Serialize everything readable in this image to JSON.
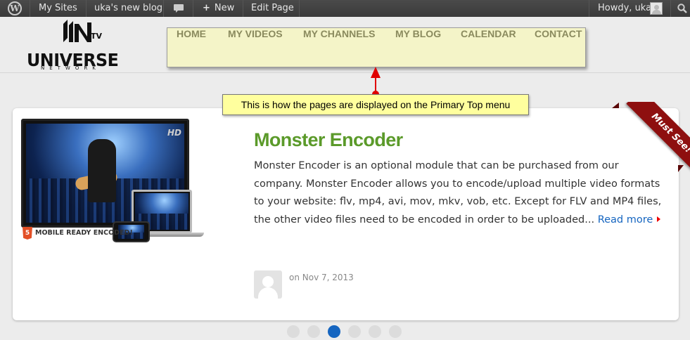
{
  "adminbar": {
    "my_sites": "My Sites",
    "site_name": "uka's new blog",
    "new_label": "New",
    "edit_page": "Edit Page",
    "greeting": "Howdy, uka"
  },
  "logo": {
    "brand": "UNIVERSE",
    "network": "NETWORK",
    "tv": "TV"
  },
  "menu": {
    "items": [
      "HOME",
      "MY VIDEOS",
      "MY CHANNELS",
      "MY BLOG",
      "CALENDAR",
      "CONTACT"
    ]
  },
  "callout": {
    "text": "This is how the pages are displayed on the Primary Top menu",
    "color": "#ffff9e",
    "arrow_color": "#e00000"
  },
  "post": {
    "title": "Monster Encoder",
    "description": "Monster Encoder is an optional module that can be purchased from our company. Monster Encoder allows you to encode/upload multiple video formats to your website: flv, mp4, avi, mov, mkv, vob, etc. Except for FLV and MP4 files, the other video files need to be encoded in order to be uploaded...",
    "read_more": "Read more",
    "date": "on Nov 7, 2013",
    "ribbon": "Must See!",
    "image_badge": "MOBILE READY ENCODED!",
    "image_hd": "HD",
    "html5": "5"
  },
  "pagination": {
    "count": 6,
    "active_index": 2
  },
  "colors": {
    "title": "#5b9a2a",
    "link": "#1565c0",
    "ribbon": "#8e0f0f",
    "menu_bg": "#f4f4c8",
    "adminbar": "#464646"
  }
}
